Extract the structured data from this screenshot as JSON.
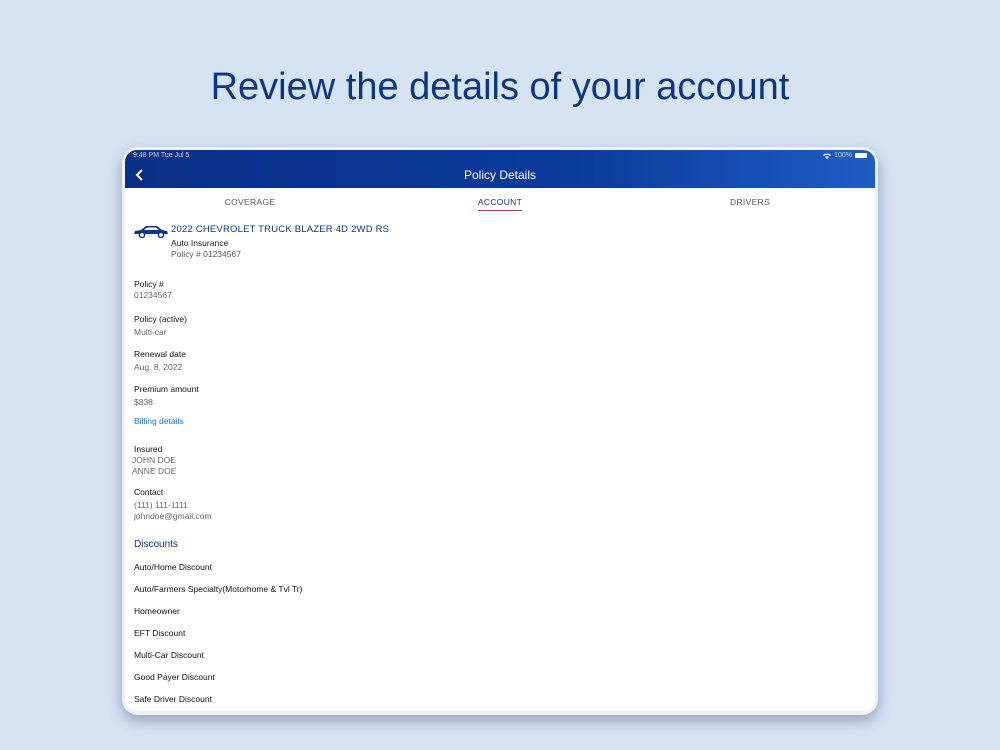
{
  "headline": "Review the details of your account",
  "status": {
    "time": "9:48 PM   Tue Jul 5",
    "battery": "100%"
  },
  "appbar": {
    "title": "Policy Details"
  },
  "tabs": [
    {
      "label": "COVERAGE"
    },
    {
      "label": "ACCOUNT",
      "active": true
    },
    {
      "label": "DRIVERS"
    }
  ],
  "vehicle": {
    "name": "2022 CHEVROLET TRUCK BLAZER 4D 2WD RS",
    "type": "Auto Insurance",
    "policy": "Policy # 01234567",
    "icon": "car-icon"
  },
  "fields": {
    "policy_number": {
      "label": "Policy #",
      "value": "01234567"
    },
    "policy_status": {
      "label": "Policy (active)",
      "value": "Multi-car"
    },
    "renewal": {
      "label": "Renewal date",
      "value": "Aug. 8, 2022"
    },
    "premium": {
      "label": "Premium amount",
      "value": "$838"
    },
    "billing_link": "Billing details",
    "insured": {
      "label": "Insured",
      "names": [
        "JOHN DOE",
        "ANNE DOE"
      ]
    },
    "contact": {
      "label": "Contact",
      "phone": "(111) 111-1111",
      "email": "johndoe@gmail.com"
    }
  },
  "discounts": {
    "title": "Discounts",
    "items": [
      "Auto/Home Discount",
      "Auto/Farmers Specialty(Motorhome & Tvl Tr)",
      "Homeowner",
      "EFT Discount",
      "Multi-Car Discount",
      "Good Payer Discount",
      "Safe Driver Discount"
    ]
  },
  "colors": {
    "brand": "#0d3580",
    "accent": "#e0245e",
    "link": "#1a73c8",
    "background": "#d6e3f3"
  }
}
